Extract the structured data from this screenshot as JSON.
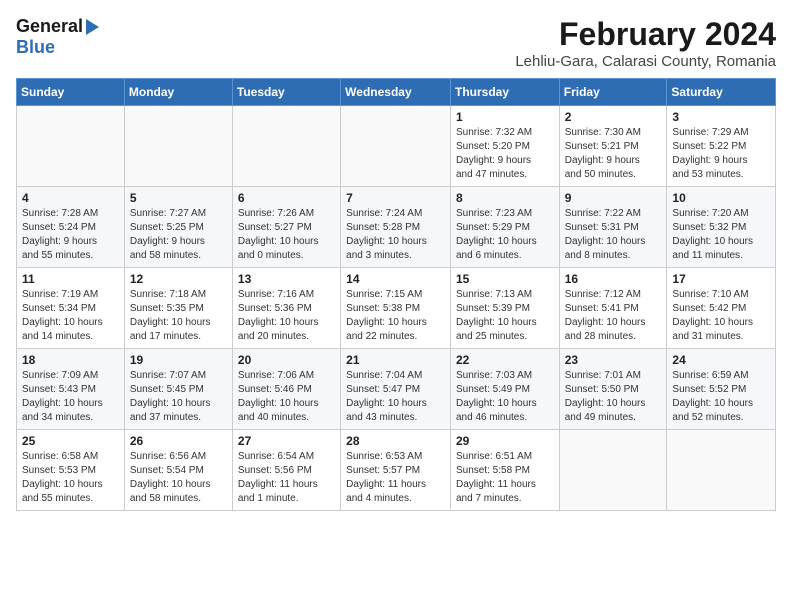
{
  "header": {
    "logo_general": "General",
    "logo_blue": "Blue",
    "month_title": "February 2024",
    "location": "Lehliu-Gara, Calarasi County, Romania"
  },
  "days_of_week": [
    "Sunday",
    "Monday",
    "Tuesday",
    "Wednesday",
    "Thursday",
    "Friday",
    "Saturday"
  ],
  "weeks": [
    [
      {
        "day": "",
        "info": ""
      },
      {
        "day": "",
        "info": ""
      },
      {
        "day": "",
        "info": ""
      },
      {
        "day": "",
        "info": ""
      },
      {
        "day": "1",
        "info": "Sunrise: 7:32 AM\nSunset: 5:20 PM\nDaylight: 9 hours\nand 47 minutes."
      },
      {
        "day": "2",
        "info": "Sunrise: 7:30 AM\nSunset: 5:21 PM\nDaylight: 9 hours\nand 50 minutes."
      },
      {
        "day": "3",
        "info": "Sunrise: 7:29 AM\nSunset: 5:22 PM\nDaylight: 9 hours\nand 53 minutes."
      }
    ],
    [
      {
        "day": "4",
        "info": "Sunrise: 7:28 AM\nSunset: 5:24 PM\nDaylight: 9 hours\nand 55 minutes."
      },
      {
        "day": "5",
        "info": "Sunrise: 7:27 AM\nSunset: 5:25 PM\nDaylight: 9 hours\nand 58 minutes."
      },
      {
        "day": "6",
        "info": "Sunrise: 7:26 AM\nSunset: 5:27 PM\nDaylight: 10 hours\nand 0 minutes."
      },
      {
        "day": "7",
        "info": "Sunrise: 7:24 AM\nSunset: 5:28 PM\nDaylight: 10 hours\nand 3 minutes."
      },
      {
        "day": "8",
        "info": "Sunrise: 7:23 AM\nSunset: 5:29 PM\nDaylight: 10 hours\nand 6 minutes."
      },
      {
        "day": "9",
        "info": "Sunrise: 7:22 AM\nSunset: 5:31 PM\nDaylight: 10 hours\nand 8 minutes."
      },
      {
        "day": "10",
        "info": "Sunrise: 7:20 AM\nSunset: 5:32 PM\nDaylight: 10 hours\nand 11 minutes."
      }
    ],
    [
      {
        "day": "11",
        "info": "Sunrise: 7:19 AM\nSunset: 5:34 PM\nDaylight: 10 hours\nand 14 minutes."
      },
      {
        "day": "12",
        "info": "Sunrise: 7:18 AM\nSunset: 5:35 PM\nDaylight: 10 hours\nand 17 minutes."
      },
      {
        "day": "13",
        "info": "Sunrise: 7:16 AM\nSunset: 5:36 PM\nDaylight: 10 hours\nand 20 minutes."
      },
      {
        "day": "14",
        "info": "Sunrise: 7:15 AM\nSunset: 5:38 PM\nDaylight: 10 hours\nand 22 minutes."
      },
      {
        "day": "15",
        "info": "Sunrise: 7:13 AM\nSunset: 5:39 PM\nDaylight: 10 hours\nand 25 minutes."
      },
      {
        "day": "16",
        "info": "Sunrise: 7:12 AM\nSunset: 5:41 PM\nDaylight: 10 hours\nand 28 minutes."
      },
      {
        "day": "17",
        "info": "Sunrise: 7:10 AM\nSunset: 5:42 PM\nDaylight: 10 hours\nand 31 minutes."
      }
    ],
    [
      {
        "day": "18",
        "info": "Sunrise: 7:09 AM\nSunset: 5:43 PM\nDaylight: 10 hours\nand 34 minutes."
      },
      {
        "day": "19",
        "info": "Sunrise: 7:07 AM\nSunset: 5:45 PM\nDaylight: 10 hours\nand 37 minutes."
      },
      {
        "day": "20",
        "info": "Sunrise: 7:06 AM\nSunset: 5:46 PM\nDaylight: 10 hours\nand 40 minutes."
      },
      {
        "day": "21",
        "info": "Sunrise: 7:04 AM\nSunset: 5:47 PM\nDaylight: 10 hours\nand 43 minutes."
      },
      {
        "day": "22",
        "info": "Sunrise: 7:03 AM\nSunset: 5:49 PM\nDaylight: 10 hours\nand 46 minutes."
      },
      {
        "day": "23",
        "info": "Sunrise: 7:01 AM\nSunset: 5:50 PM\nDaylight: 10 hours\nand 49 minutes."
      },
      {
        "day": "24",
        "info": "Sunrise: 6:59 AM\nSunset: 5:52 PM\nDaylight: 10 hours\nand 52 minutes."
      }
    ],
    [
      {
        "day": "25",
        "info": "Sunrise: 6:58 AM\nSunset: 5:53 PM\nDaylight: 10 hours\nand 55 minutes."
      },
      {
        "day": "26",
        "info": "Sunrise: 6:56 AM\nSunset: 5:54 PM\nDaylight: 10 hours\nand 58 minutes."
      },
      {
        "day": "27",
        "info": "Sunrise: 6:54 AM\nSunset: 5:56 PM\nDaylight: 11 hours\nand 1 minute."
      },
      {
        "day": "28",
        "info": "Sunrise: 6:53 AM\nSunset: 5:57 PM\nDaylight: 11 hours\nand 4 minutes."
      },
      {
        "day": "29",
        "info": "Sunrise: 6:51 AM\nSunset: 5:58 PM\nDaylight: 11 hours\nand 7 minutes."
      },
      {
        "day": "",
        "info": ""
      },
      {
        "day": "",
        "info": ""
      }
    ]
  ]
}
